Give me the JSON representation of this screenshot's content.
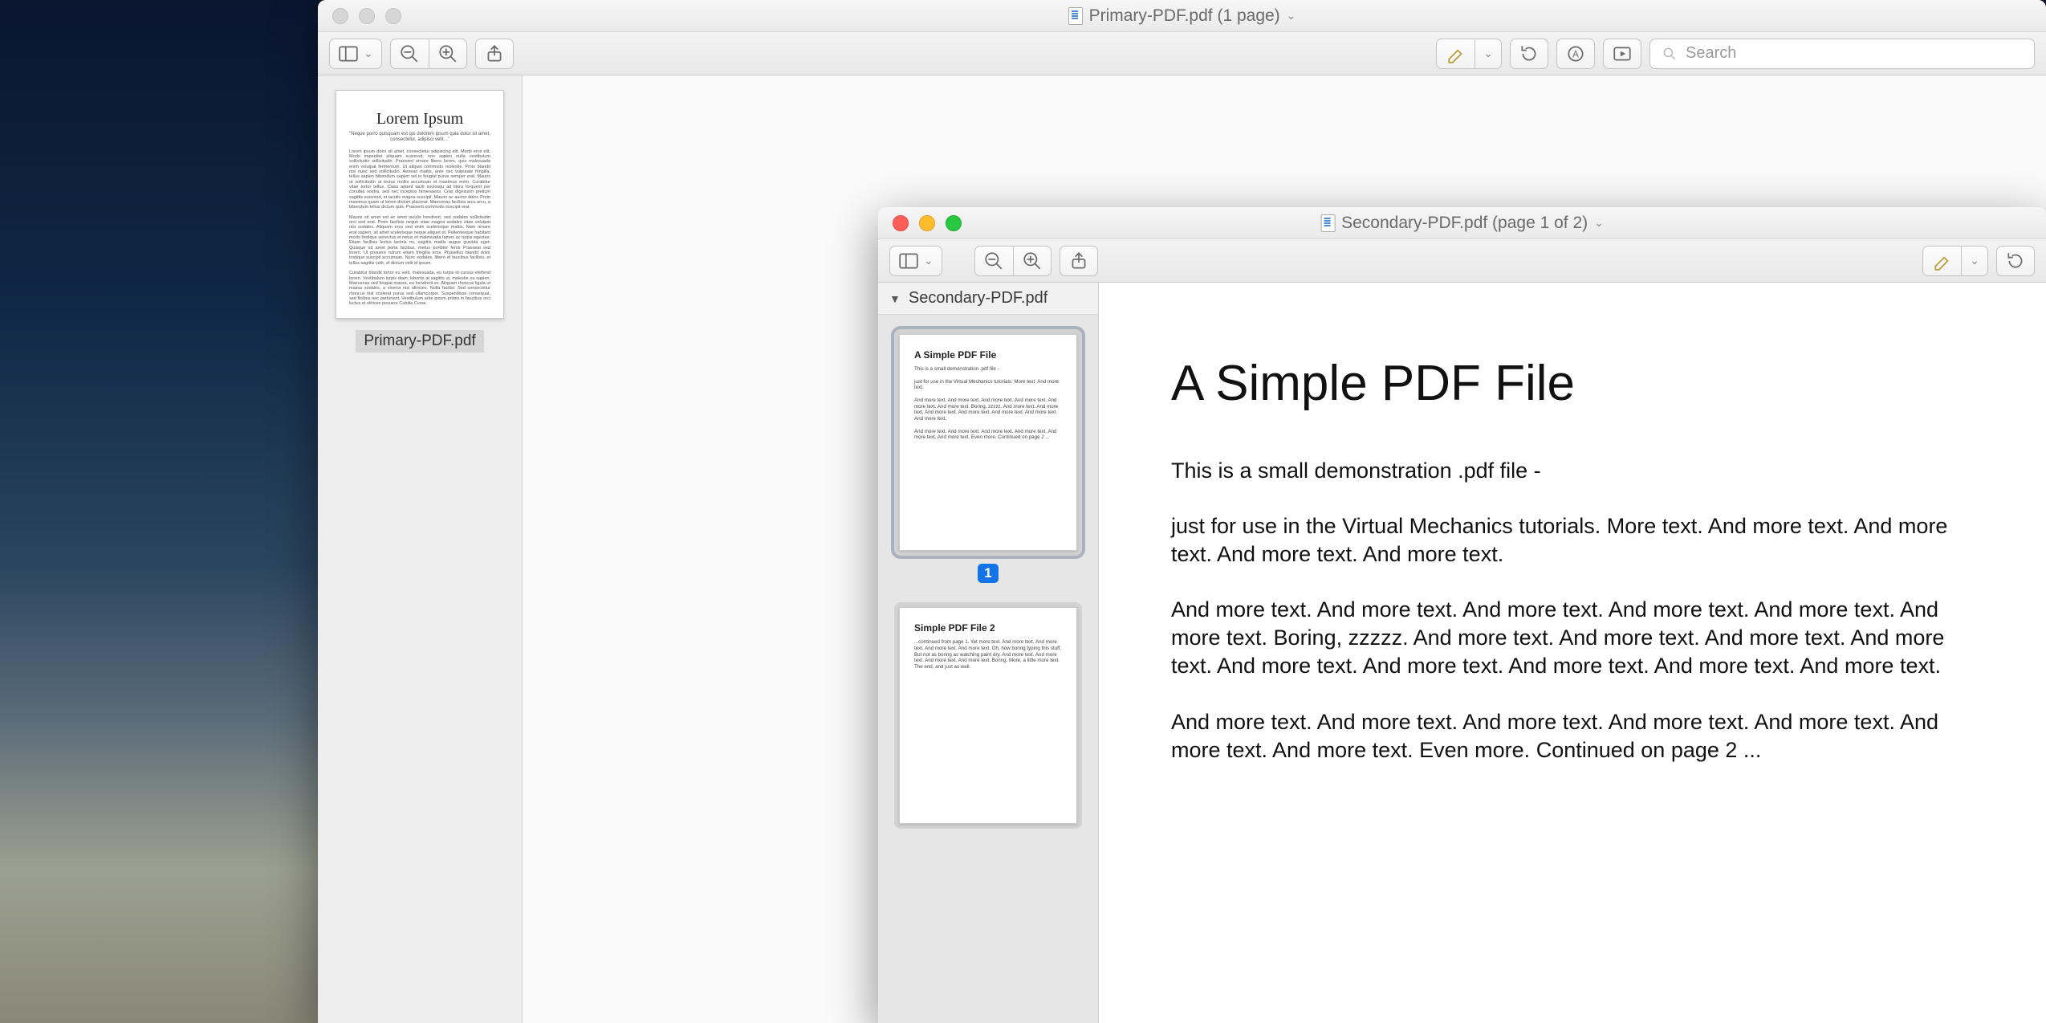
{
  "primary": {
    "title": "Primary-PDF.pdf (1 page)",
    "search_placeholder": "Search",
    "thumb_label": "Primary-PDF.pdf",
    "thumb_title": "Lorem Ipsum",
    "thumb_subtitle": "\"Neque porro quisquam est qui dolorem ipsum quia dolor sit amet, consectetur, adipisci velit...\""
  },
  "secondary": {
    "title": "Secondary-PDF.pdf (page 1 of 2)",
    "sidebar_heading": "Secondary-PDF.pdf",
    "page1_number": "1",
    "thumb1_title": "A Simple PDF File",
    "thumb2_title": "Simple PDF File 2",
    "doc": {
      "heading": "A Simple PDF File",
      "p1": "This is a small demonstration .pdf file -",
      "p2": "just for use in the Virtual Mechanics tutorials. More text. And more text. And more text. And more text. And more text.",
      "p3": "And more text. And more text. And more text. And more text. And more text. And more text. Boring, zzzzz. And more text. And more text. And more text. And more text. And more text. And more text. And more text. And more text. And more text.",
      "p4": "And more text. And more text. And more text. And more text. And more text. And more text. And more text. Even more. Continued on page 2 ..."
    }
  }
}
